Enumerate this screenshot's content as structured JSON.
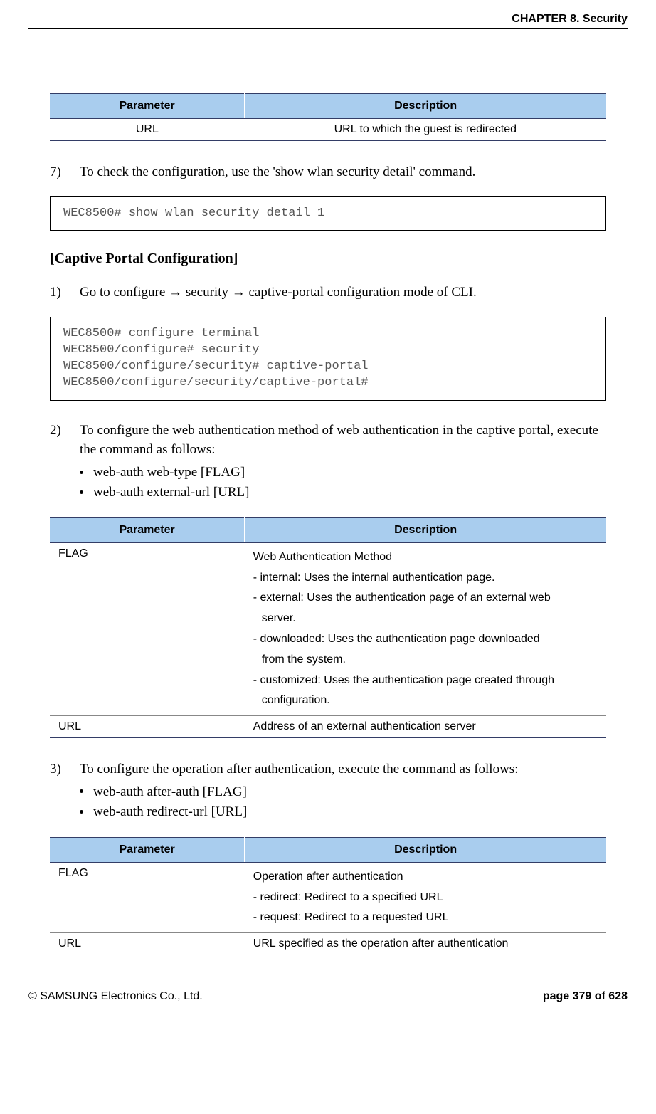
{
  "header": {
    "chapter": "CHAPTER 8. Security"
  },
  "table1": {
    "h1": "Parameter",
    "h2": "Description",
    "rows": [
      {
        "p": "URL",
        "d": "URL to which the guest is redirected"
      }
    ]
  },
  "step7": {
    "num": "7)",
    "text": "To check the configuration, use the 'show wlan security detail' command."
  },
  "code1": "WEC8500# show wlan security detail 1",
  "section_heading": "[Captive Portal Configuration]",
  "cp_step1": {
    "num": "1)",
    "pre": "Go to configure ",
    "mid1": " security ",
    "mid2": " captive-portal configuration mode of CLI.",
    "arrow": "→"
  },
  "code2": "WEC8500# configure terminal\nWEC8500/configure# security\nWEC8500/configure/security# captive-portal\nWEC8500/configure/security/captive-portal#",
  "cp_step2": {
    "num": "2)",
    "text": "To configure the web authentication method of web authentication in the captive portal, execute the command as follows:",
    "bullets": [
      "web-auth web-type [FLAG]",
      "web-auth external-url [URL]"
    ]
  },
  "table2": {
    "h1": "Parameter",
    "h2": "Description",
    "row1": {
      "p": "FLAG",
      "l1": "Web Authentication Method",
      "l2": "- internal: Uses the internal authentication page.",
      "l3a": "- external: Uses the authentication page of an external web",
      "l3b": "server.",
      "l4a": "- downloaded: Uses the authentication page downloaded",
      "l4b": "from the system.",
      "l5a": "- customized: Uses the authentication page created through",
      "l5b": "configuration."
    },
    "row2": {
      "p": "URL",
      "d": "Address of an external authentication server"
    }
  },
  "cp_step3": {
    "num": "3)",
    "text": "To configure the operation after authentication, execute the command as follows:",
    "bullets": [
      "web-auth after-auth [FLAG]",
      "web-auth redirect-url [URL]"
    ]
  },
  "table3": {
    "h1": "Parameter",
    "h2": "Description",
    "row1": {
      "p": "FLAG",
      "l1": "Operation after authentication",
      "l2": "- redirect: Redirect to a specified URL",
      "l3": "- request: Redirect to a requested URL"
    },
    "row2": {
      "p": "URL",
      "d": "URL specified as the operation after authentication"
    }
  },
  "footer": {
    "copyright": "© SAMSUNG Electronics Co., Ltd.",
    "page": "page 379 of 628"
  }
}
